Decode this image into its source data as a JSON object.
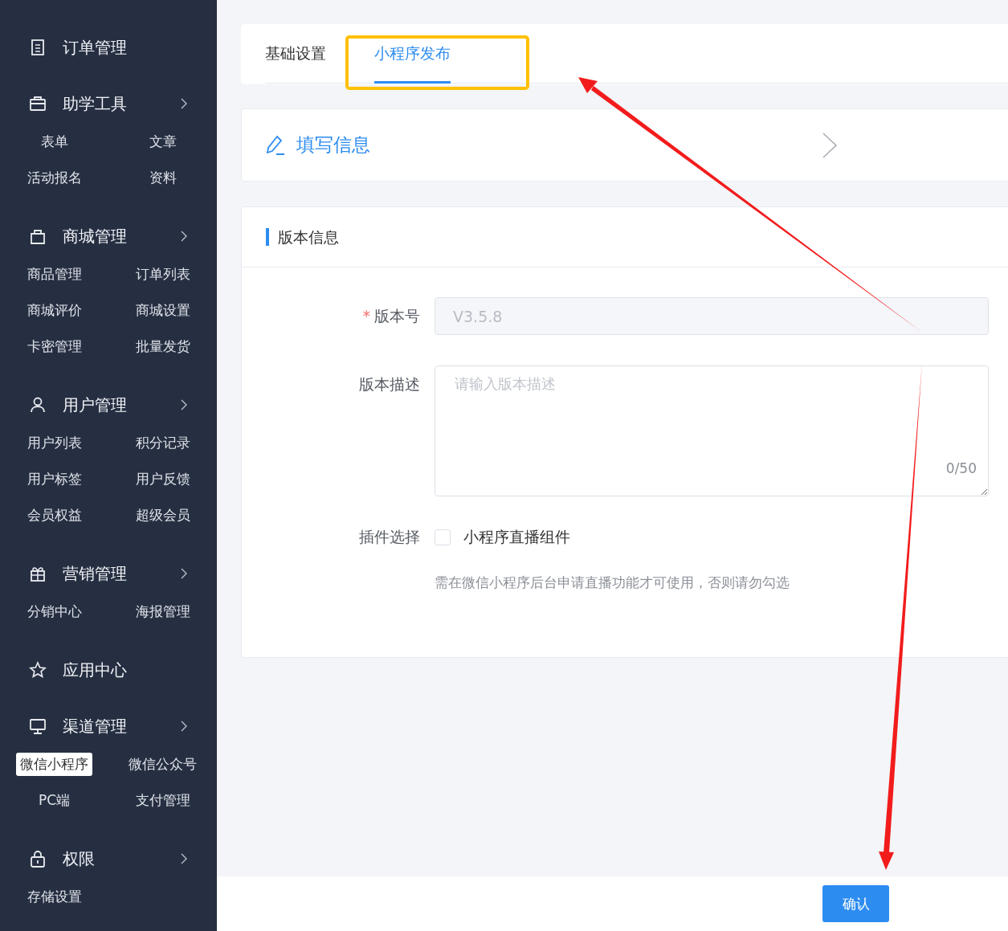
{
  "sidebar": {
    "groups": [
      {
        "title": "订单管理",
        "expandable": false
      },
      {
        "title": "助学工具",
        "expandable": true,
        "items": [
          {
            "label": "表单",
            "selected": false
          },
          {
            "label": "文章",
            "selected": false
          },
          {
            "label": "活动报名",
            "selected": false
          },
          {
            "label": "资料",
            "selected": false
          }
        ]
      },
      {
        "title": "商城管理",
        "expandable": true,
        "items": [
          {
            "label": "商品管理",
            "selected": false
          },
          {
            "label": "订单列表",
            "selected": false
          },
          {
            "label": "商城评价",
            "selected": false
          },
          {
            "label": "商城设置",
            "selected": false
          },
          {
            "label": "卡密管理",
            "selected": false
          },
          {
            "label": "批量发货",
            "selected": false
          }
        ]
      },
      {
        "title": "用户管理",
        "expandable": true,
        "items": [
          {
            "label": "用户列表",
            "selected": false
          },
          {
            "label": "积分记录",
            "selected": false
          },
          {
            "label": "用户标签",
            "selected": false
          },
          {
            "label": "用户反馈",
            "selected": false
          },
          {
            "label": "会员权益",
            "selected": false
          },
          {
            "label": "超级会员",
            "selected": false
          }
        ]
      },
      {
        "title": "营销管理",
        "expandable": true,
        "items": [
          {
            "label": "分销中心",
            "selected": false
          },
          {
            "label": "海报管理",
            "selected": false
          }
        ]
      },
      {
        "title": "应用中心",
        "expandable": false
      },
      {
        "title": "渠道管理",
        "expandable": true,
        "items": [
          {
            "label": "微信小程序",
            "selected": true
          },
          {
            "label": "微信公众号",
            "selected": false
          },
          {
            "label": "PC端",
            "selected": false
          },
          {
            "label": "支付管理",
            "selected": false
          }
        ]
      },
      {
        "title": "权限",
        "expandable": true,
        "items": [
          {
            "label": "存储设置",
            "selected": false
          }
        ]
      }
    ]
  },
  "tabs": [
    {
      "label": "基础设置",
      "selected": false
    },
    {
      "label": "小程序发布",
      "selected": true
    }
  ],
  "step": {
    "title": "填写信息"
  },
  "section": {
    "title": "版本信息"
  },
  "form": {
    "version": {
      "label": "版本号",
      "required_mark": "*",
      "value": "V3.5.8",
      "disabled": true
    },
    "description": {
      "label": "版本描述",
      "placeholder": "请输入版本描述",
      "counter": "0/50"
    },
    "plugin": {
      "label": "插件选择",
      "option": "小程序直播组件",
      "checked": false,
      "hint": "需在微信小程序后台申请直播功能才可使用，否则请勿勾选"
    }
  },
  "footer": {
    "button": "确认"
  }
}
